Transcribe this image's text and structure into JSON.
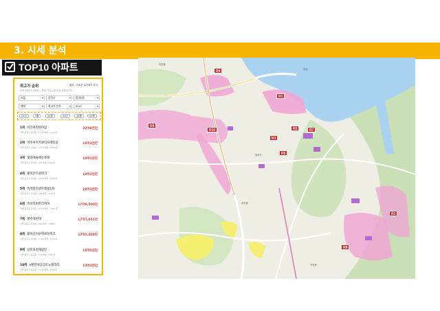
{
  "section": {
    "title": "3. 시세 분석"
  },
  "top10": {
    "title": "TOP10 아파트"
  },
  "panel": {
    "heading": "최고가 순위",
    "right_note": "출처 : 국토부 실거래가 분석",
    "sub_text": "최저 최고가 아파트 · 보유 기간 2년 이상 정보입니다",
    "selects": {
      "region": "서울",
      "district": "동작구",
      "dong": "읍/면/동",
      "trade": "매매",
      "sort": "최고가 순위",
      "area": "84㎡"
    },
    "filters": [
      "21년",
      "1월",
      "20평",
      "21년",
      "12월",
      "20평"
    ],
    "items": [
      {
        "rank": "1위",
        "name": "아크로리버하임",
        "meta": "서울 동작구 흑석동 · 1,073세대 · 2019년",
        "price": "22억8천만"
      },
      {
        "rank": "2위",
        "name": "이수푸르지오더프레티움",
        "meta": "서울 동작구 사당동 · 1,101세대 · 2019년",
        "price": "18억3천만"
      },
      {
        "rank": "3위",
        "name": "롯데캐슬에듀포레",
        "meta": "서울 동작구 흑석동 · 545세대 · 2019년",
        "price": "18억3천만"
      },
      {
        "rank": "4위",
        "name": "래미안트윈파크",
        "meta": "서울 동작구 사당동 · 2,018세대 · 2016년",
        "price": "18억1천만"
      },
      {
        "rank": "5위",
        "name": "흑석한강센트레빌1차",
        "meta": "서울 동작구 흑석동 · 655세대 · 2011년",
        "price": "18억1천만"
      },
      {
        "rank": "6위",
        "name": "흑석리버파크자이",
        "meta": "서울 동작구 흑석동 · 1,772세대 · 2023년",
        "price": "17억9,500만"
      },
      {
        "rank": "7위",
        "name": "명수대현대",
        "meta": "서울 동작구 흑석동 · 660세대 · 1988년",
        "price": "17억7,851만"
      },
      {
        "rank": "8위",
        "name": "래미안이수역로이파크",
        "meta": "서울 동작구 사당동 · 1,020세대 · 2014년",
        "price": "17억5,800만"
      },
      {
        "rank": "9위",
        "name": "상도효성해링턴",
        "meta": "서울 동작구 상도동 · 548세대 · 2017년",
        "price": "15억5천만"
      },
      {
        "rank": "10위",
        "name": "e편한세상상도노빌리티",
        "meta": "서울 동작구 상도동 · 1,122세대 · 2018년",
        "price": "13억1천만"
      }
    ]
  },
  "map": {
    "markers": [
      "R4",
      "R1",
      "R9",
      "R10",
      "R3",
      "R5",
      "R7",
      "R6",
      "R2",
      "R8"
    ],
    "labels": {
      "river": "한강",
      "north": "이촌동",
      "district": "동작구",
      "sangdo": "상도동",
      "sadang": "사당동"
    }
  },
  "colors": {
    "accent": "#f6b400",
    "dark": "#151515",
    "marker": "#d3242a",
    "river": "#a9d3f0",
    "park": "#c7dfb3",
    "zone_pink": "#f0a6d4",
    "zone_yellow": "#f4ef70"
  }
}
